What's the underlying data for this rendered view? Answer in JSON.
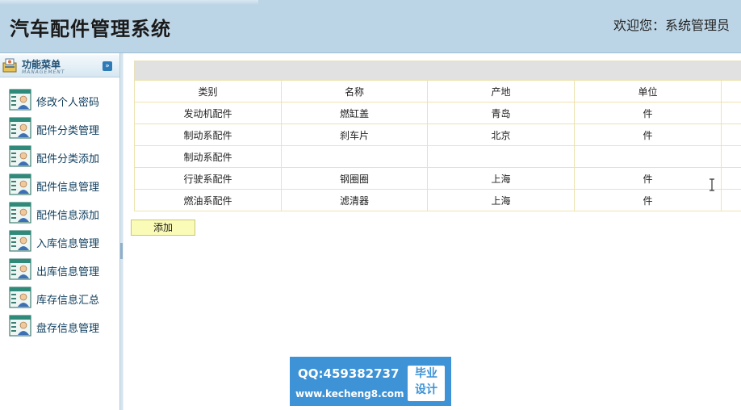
{
  "app": {
    "title": "汽车配件管理系统",
    "welcome": "欢迎您：系统管理员"
  },
  "sidebar": {
    "header_title": "功能菜单",
    "header_subtitle": "MANAGEMENT",
    "toggle_icon": "double-chevron-down-icon",
    "items": [
      {
        "label": "修改个人密码",
        "icon": "user-card-icon"
      },
      {
        "label": "配件分类管理",
        "icon": "user-card-icon"
      },
      {
        "label": "配件分类添加",
        "icon": "user-card-icon"
      },
      {
        "label": "配件信息管理",
        "icon": "user-card-icon"
      },
      {
        "label": "配件信息添加",
        "icon": "user-card-icon"
      },
      {
        "label": "入库信息管理",
        "icon": "user-card-icon"
      },
      {
        "label": "出库信息管理",
        "icon": "user-card-icon"
      },
      {
        "label": "库存信息汇总",
        "icon": "user-card-icon"
      },
      {
        "label": "盘存信息管理",
        "icon": "user-card-icon"
      }
    ]
  },
  "table": {
    "columns": [
      "类别",
      "名称",
      "产地",
      "单位",
      ""
    ],
    "rows": [
      [
        "发动机配件",
        "燃缸盖",
        "青岛",
        "件",
        ""
      ],
      [
        "制动系配件",
        "刹车片",
        "北京",
        "件",
        ""
      ],
      [
        "制动系配件",
        "",
        "",
        "",
        ""
      ],
      [
        "行驶系配件",
        "钢圈圈",
        "上海",
        "件",
        ""
      ],
      [
        "燃油系配件",
        "滤清器",
        "上海",
        "件",
        ""
      ]
    ]
  },
  "actions": {
    "add_label": "添加"
  },
  "watermark": {
    "qq": "QQ:459382737",
    "url": "www.kecheng8.com",
    "badge_line1": "毕业",
    "badge_line2": "设计"
  },
  "colors": {
    "header_bg": "#bcd5e6",
    "menu_text": "#0e3d5c",
    "table_border": "#ece3b0",
    "add_button_bg": "#fbfbb8",
    "watermark_bg": "#3d93d6"
  }
}
